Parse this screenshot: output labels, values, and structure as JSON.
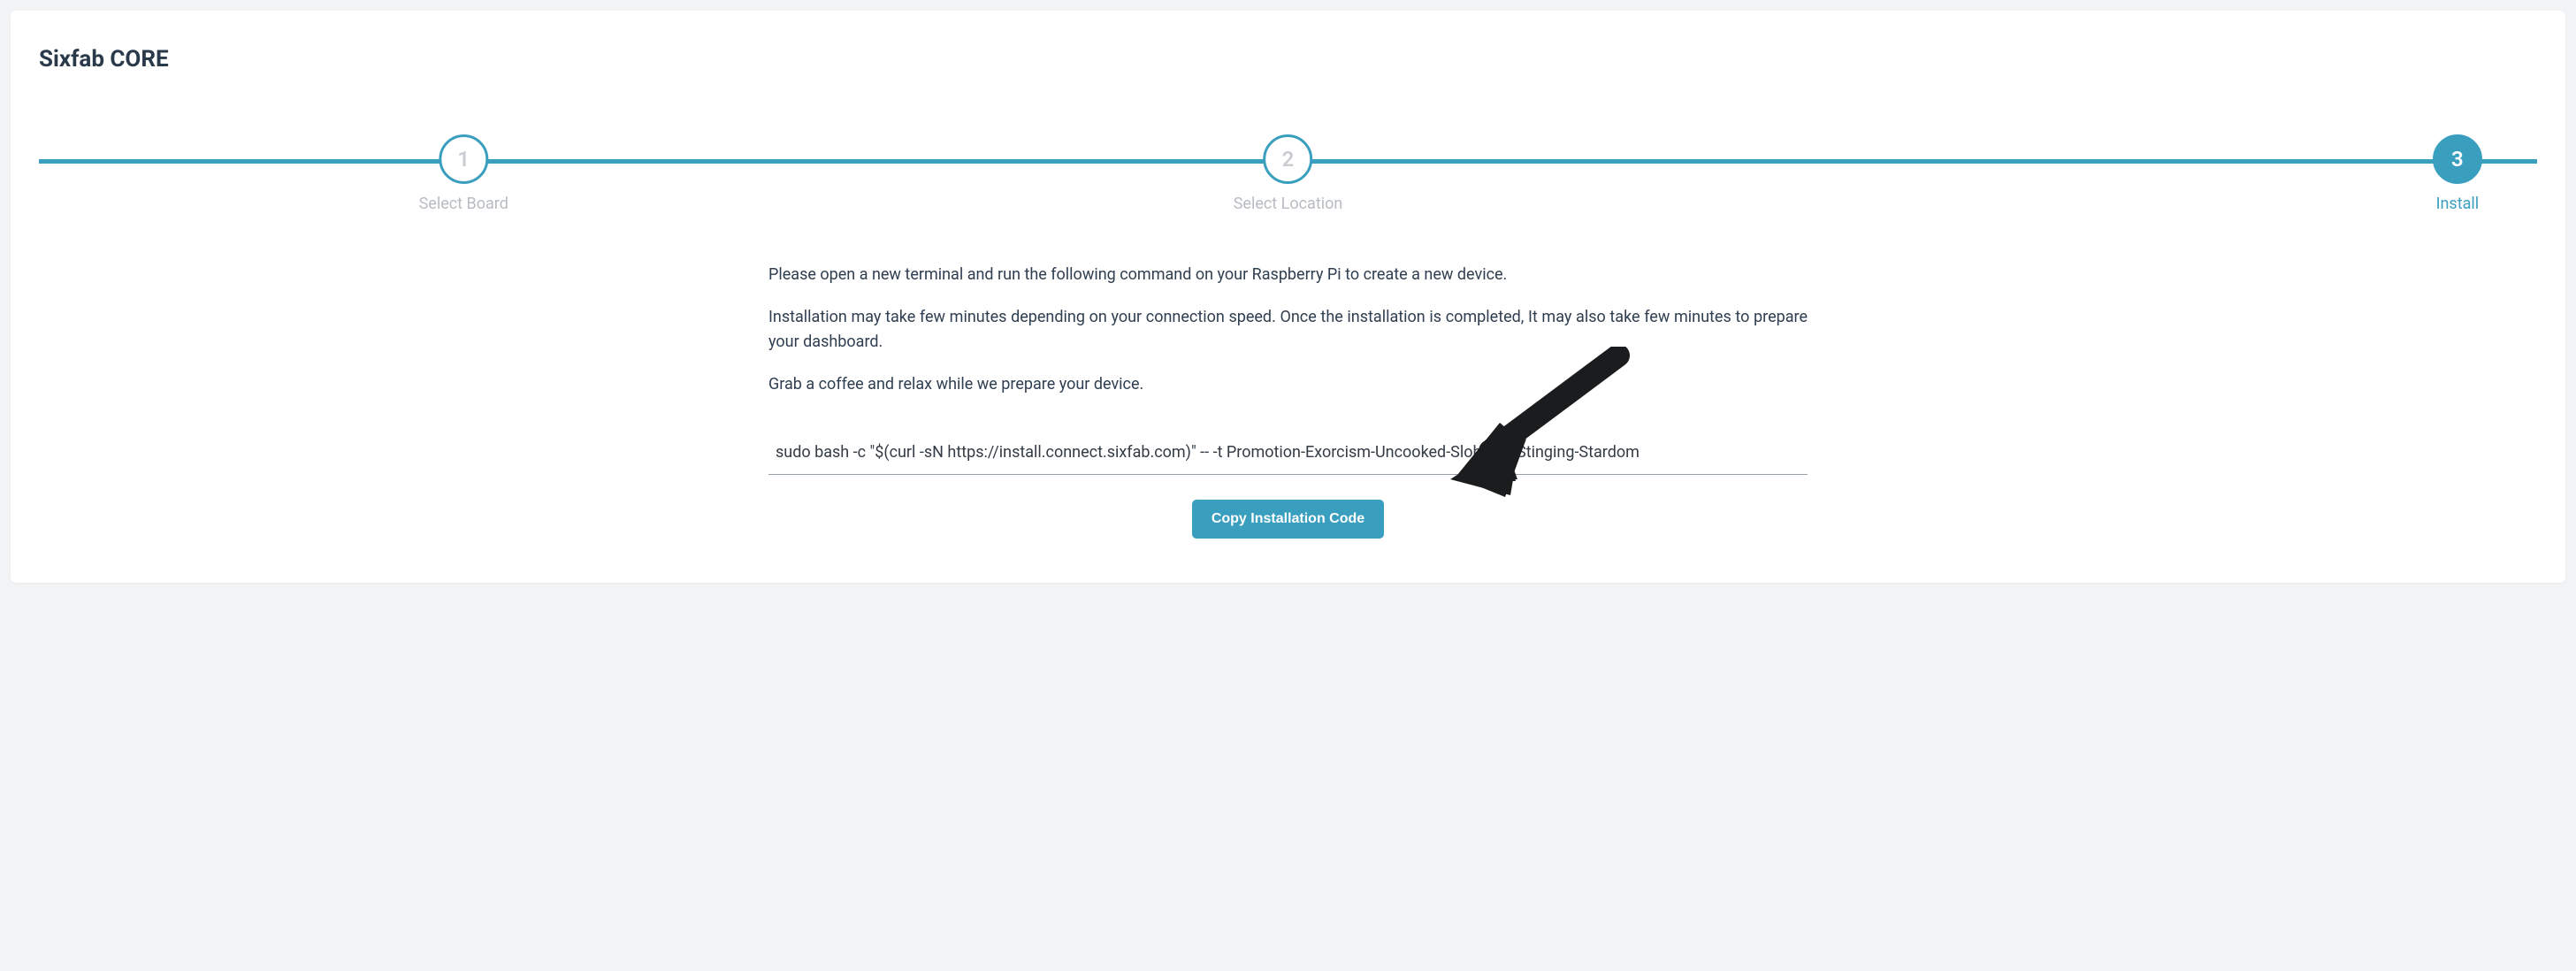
{
  "title": "Sixfab CORE",
  "stepper": {
    "steps": [
      {
        "num": "1",
        "label": "Select Board",
        "active": false
      },
      {
        "num": "2",
        "label": "Select Location",
        "active": false
      },
      {
        "num": "3",
        "label": "Install",
        "active": true
      }
    ]
  },
  "instructions": {
    "p1": "Please open a new terminal and run the following command on your Raspberry Pi to create a new device.",
    "p2": "Installation may take few minutes depending on your connection speed. Once the installation is completed, It may also take few minutes to prepare your dashboard.",
    "p3": "Grab a coffee and relax while we prepare your device."
  },
  "code_value": "sudo bash -c \"$(curl -sN https://install.connect.sixfab.com)\" -- -t Promotion-Exorcism-Uncooked-Slobbery-Stinging-Stardom",
  "copy_button_label": "Copy Installation Code",
  "colors": {
    "accent": "#3a9fbf",
    "text_dark": "#2b3a4a",
    "muted": "#b7bcc2"
  }
}
